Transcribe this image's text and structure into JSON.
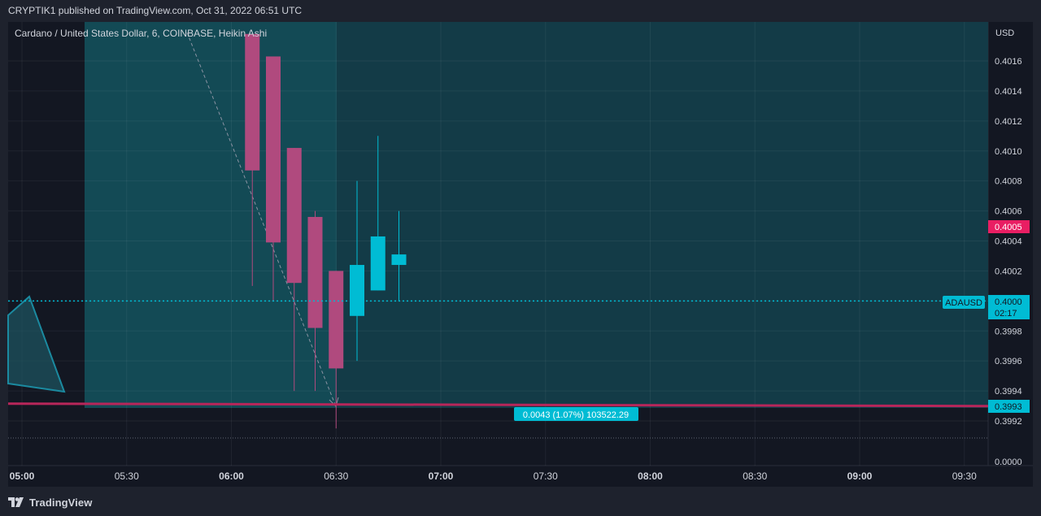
{
  "header": {
    "publish_line": "CRYPTIK1 published on TradingView.com, Oct 31, 2022 06:51 UTC"
  },
  "chart": {
    "symbol_line": "Cardano / United States Dollar, 6, COINBASE, Heikin Ashi",
    "currency": "USD"
  },
  "footer": {
    "brand": "TradingView"
  },
  "colors": {
    "up": "#00bcd4",
    "down": "#b04a7e",
    "bg": "#131722",
    "band": "#134a55",
    "zone": "#133b47",
    "line": "#b8265a"
  },
  "chart_data": {
    "type": "candlestick",
    "style": "Heikin Ashi",
    "symbol": "ADAUSD",
    "interval": "6",
    "exchange": "COINBASE",
    "ylim": [
      0.39915,
      0.40178
    ],
    "y_ticks": [
      "0.4016",
      "0.4014",
      "0.4012",
      "0.4010",
      "0.4008",
      "0.4006",
      "0.4004",
      "0.4002",
      "0.4000",
      "0.3998",
      "0.3996",
      "0.3994",
      "0.3992"
    ],
    "x_ticks": [
      {
        "time": "05:00",
        "bold": true
      },
      {
        "time": "05:30",
        "bold": false
      },
      {
        "time": "06:00",
        "bold": true
      },
      {
        "time": "06:30",
        "bold": false
      },
      {
        "time": "07:00",
        "bold": true
      },
      {
        "time": "07:30",
        "bold": false
      },
      {
        "time": "08:00",
        "bold": true
      },
      {
        "time": "08:30",
        "bold": false
      },
      {
        "time": "09:00",
        "bold": true
      },
      {
        "time": "09:30",
        "bold": false
      }
    ],
    "candles": [
      {
        "time": "06:06",
        "open": 0.40178,
        "close": 0.40087,
        "high": 0.40178,
        "low": 0.4001
      },
      {
        "time": "06:12",
        "open": 0.40163,
        "close": 0.40039,
        "high": 0.40163,
        "low": 0.4
      },
      {
        "time": "06:18",
        "open": 0.40102,
        "close": 0.40012,
        "high": 0.40102,
        "low": 0.3994
      },
      {
        "time": "06:24",
        "open": 0.40056,
        "close": 0.39982,
        "high": 0.4006,
        "low": 0.3994
      },
      {
        "time": "06:30",
        "open": 0.4002,
        "close": 0.39955,
        "high": 0.4002,
        "low": 0.39915
      },
      {
        "time": "06:36",
        "open": 0.3999,
        "close": 0.40024,
        "high": 0.4008,
        "low": 0.3996
      },
      {
        "time": "06:42",
        "open": 0.40007,
        "close": 0.40043,
        "high": 0.4011,
        "low": 0.40007
      },
      {
        "time": "06:48",
        "open": 0.40024,
        "close": 0.40031,
        "high": 0.4006,
        "low": 0.4
      }
    ],
    "current_price": {
      "value": "0.4000",
      "label": "ADAUSD",
      "countdown": "02:17"
    },
    "price_labels": [
      {
        "value": "0.4005",
        "color": "#e91e63"
      },
      {
        "value": "0.3993",
        "color": "#00bcd4"
      },
      {
        "value": "0.0000",
        "color": "#131722"
      }
    ],
    "measure_label": "0.0043 (1.07%) 103522.29",
    "horizontal_level": 0.39931
  }
}
